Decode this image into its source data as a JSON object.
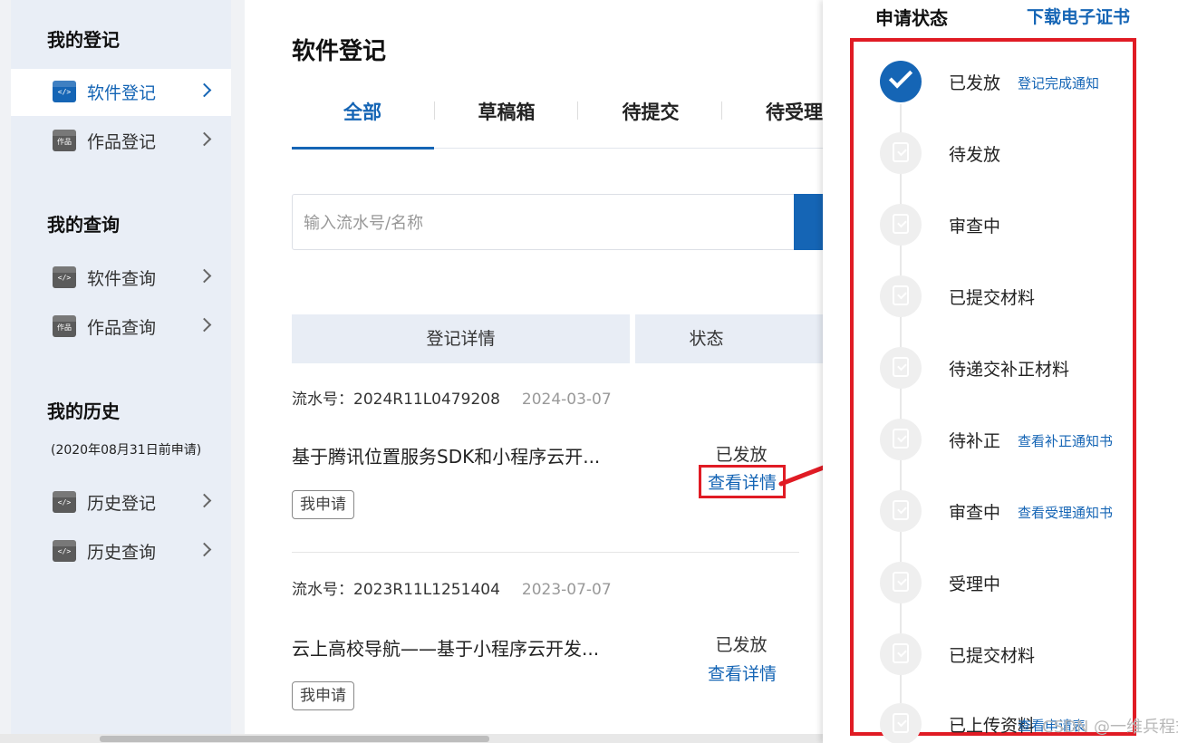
{
  "sidebar": {
    "groups": [
      {
        "title": "我的登记",
        "items": [
          {
            "label": "软件登记",
            "icon": "software-register-icon",
            "active": true
          },
          {
            "label": "作品登记",
            "icon": "work-register-icon",
            "active": false
          }
        ]
      },
      {
        "title": "我的查询",
        "items": [
          {
            "label": "软件查询",
            "icon": "software-query-icon"
          },
          {
            "label": "作品查询",
            "icon": "work-query-icon"
          }
        ]
      },
      {
        "title": "我的历史",
        "subtitle": "(2020年08月31日前申请)",
        "items": [
          {
            "label": "历史登记",
            "icon": "history-register-icon"
          },
          {
            "label": "历史查询",
            "icon": "history-query-icon"
          }
        ]
      }
    ]
  },
  "main": {
    "title": "软件登记",
    "tabs": [
      {
        "label": "全部",
        "active": true
      },
      {
        "label": "草稿箱"
      },
      {
        "label": "待提交"
      },
      {
        "label": "待受理"
      }
    ],
    "search": {
      "placeholder": "输入流水号/名称"
    },
    "table": {
      "headers": [
        "登记详情",
        "状态"
      ],
      "records": [
        {
          "serial_label": "流水号：",
          "serial": "2024R11L0479208",
          "date": "2024-03-07",
          "title": "基于腾讯位置服务SDK和小程序云开...",
          "tag": "我申请",
          "status": "已发放",
          "detail_link": "查看详情"
        },
        {
          "serial_label": "流水号：",
          "serial": "2023R11L1251404",
          "date": "2023-07-07",
          "title": "云上高校导航——基于小程序云开发...",
          "tag": "我申请",
          "status": "已发放",
          "detail_link": "查看详情"
        }
      ]
    }
  },
  "panel": {
    "title": "申请状态",
    "download_link": "下载电子证书",
    "steps": [
      {
        "name": "已发放",
        "link": "登记完成通知",
        "done": true
      },
      {
        "name": "待发放",
        "link": ""
      },
      {
        "name": "审查中",
        "link": ""
      },
      {
        "name": "已提交材料",
        "link": ""
      },
      {
        "name": "待递交补正材料",
        "link": ""
      },
      {
        "name": "待补正",
        "link": "查看补正通知书"
      },
      {
        "name": "审查中",
        "link": "查看受理通知书"
      },
      {
        "name": "受理中",
        "link": ""
      },
      {
        "name": "已提交材料",
        "link": ""
      },
      {
        "name": "已上传资料",
        "link": "查看申请表"
      }
    ]
  },
  "watermark": "CSDN @一维兵程式",
  "colors": {
    "accent": "#1565b5",
    "highlight": "#e01b24"
  }
}
